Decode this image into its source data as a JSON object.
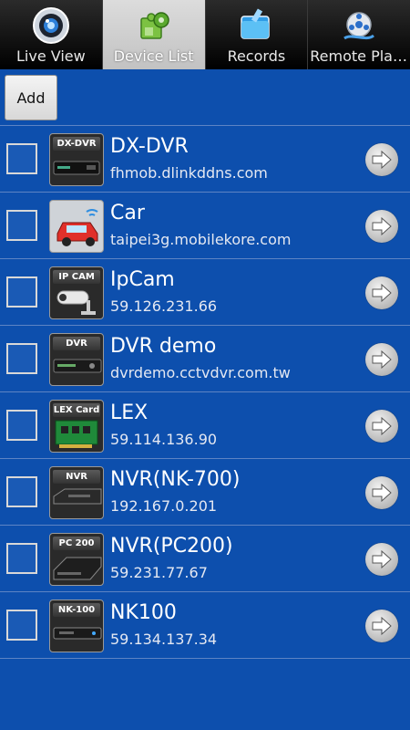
{
  "tabs": [
    {
      "label": "Live View",
      "icon": "camera-lens-icon",
      "active": false
    },
    {
      "label": "Device List",
      "icon": "puzzle-gear-icon",
      "active": true
    },
    {
      "label": "Records",
      "icon": "folder-icon",
      "active": false
    },
    {
      "label": "Remote Play..",
      "icon": "film-reel-icon",
      "active": false
    }
  ],
  "toolbar": {
    "add_label": "Add"
  },
  "devices": [
    {
      "name": "DX-DVR",
      "host": "fhmob.dlinkddns.com",
      "badge": "DX-DVR",
      "icon": "dvr-icon"
    },
    {
      "name": "Car",
      "host": "taipei3g.mobilekore.com",
      "badge": "",
      "icon": "car-icon"
    },
    {
      "name": "IpCam",
      "host": "59.126.231.66",
      "badge": "IP CAM",
      "icon": "ip-camera-icon"
    },
    {
      "name": "DVR demo",
      "host": "dvrdemo.cctvdvr.com.tw",
      "badge": "DVR",
      "icon": "dvr-icon"
    },
    {
      "name": "LEX",
      "host": "59.114.136.90",
      "badge": "LEX Card",
      "icon": "capture-card-icon"
    },
    {
      "name": "NVR(NK-700)",
      "host": "192.167.0.201",
      "badge": "NVR",
      "icon": "nvr-icon"
    },
    {
      "name": "NVR(PC200)",
      "host": "59.231.77.67",
      "badge": "PC 200",
      "icon": "nvr-icon"
    },
    {
      "name": "NK100",
      "host": "59.134.137.34",
      "badge": "NK-100",
      "icon": "nvr-icon"
    }
  ],
  "colors": {
    "background": "#0d4fad",
    "tabbar": "#000000",
    "active_tab": "#c8c8c8",
    "separator": "#5d84c4"
  }
}
